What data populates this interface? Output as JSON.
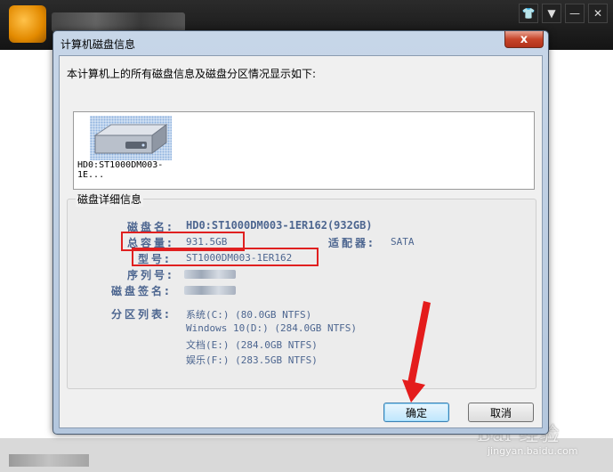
{
  "background_app": {
    "window_controls": [
      "shirt-icon",
      "dropdown-icon",
      "minimize-icon",
      "close-icon"
    ],
    "watermark_text": "Bai 经验",
    "watermark_url": "jingyan.baidu.com"
  },
  "dialog": {
    "title": "计算机磁盘信息",
    "close_label": "x",
    "intro": "本计算机上的所有磁盘信息及磁盘分区情况显示如下:",
    "disk_item": {
      "label": "HD0:ST1000DM003-1E..."
    },
    "details": {
      "group_title": "磁盘详细信息",
      "disk_name_label": "磁盘名:",
      "disk_name_value": "HD0:ST1000DM003-1ER162(932GB)",
      "capacity_label": "总容量:",
      "capacity_value": "931.5GB",
      "adapter_label": "适配器:",
      "adapter_value": "SATA",
      "model_label": "型号:",
      "model_value": "ST1000DM003-1ER162",
      "serial_label": "序列号:",
      "signature_label": "磁盘签名:",
      "partitions_label": "分区列表:",
      "partitions": [
        "系统(C:) (80.0GB NTFS)",
        "Windows 10(D:) (284.0GB NTFS)",
        "文档(E:) (284.0GB NTFS)",
        "娱乐(F:) (283.5GB NTFS)"
      ]
    },
    "ok_label": "确定",
    "cancel_label": "取消"
  },
  "colors": {
    "label_blue": "#4d6690",
    "highlight_red": "#e02020"
  }
}
